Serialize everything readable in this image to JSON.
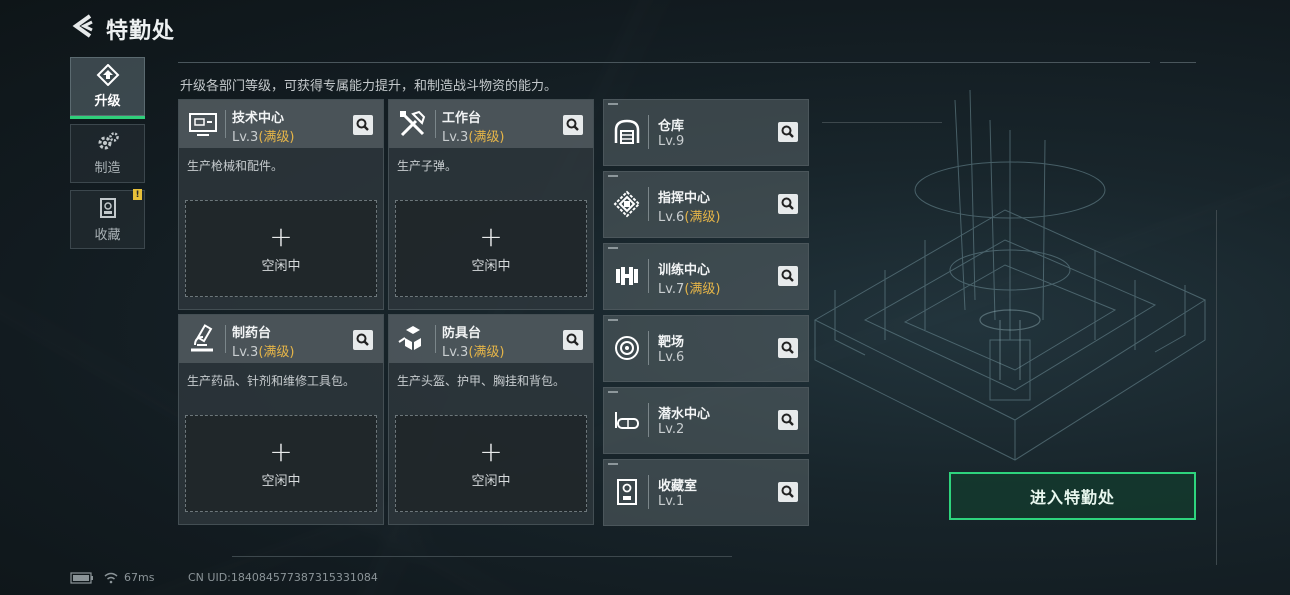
{
  "header": {
    "title": "特勤处"
  },
  "description": "升级各部门等级，可获得专属能力提升，和制造战斗物资的能力。",
  "nav": [
    {
      "label": "升级",
      "icon": "upgrade-icon",
      "active": true
    },
    {
      "label": "制造",
      "icon": "gears-icon"
    },
    {
      "label": "收藏",
      "icon": "collection-icon",
      "badge": "!"
    }
  ],
  "cards": [
    {
      "name": "技术中心",
      "level": "Lv.3",
      "max": "(满级)",
      "desc": "生产枪械和配件。",
      "icon": "computer-icon"
    },
    {
      "name": "工作台",
      "level": "Lv.3",
      "max": "(满级)",
      "desc": "生产子弹。",
      "icon": "tools-icon"
    },
    {
      "name": "制药台",
      "level": "Lv.3",
      "max": "(满级)",
      "desc": "生产药品、针剂和维修工具包。",
      "icon": "microscope-icon"
    },
    {
      "name": "防具台",
      "level": "Lv.3",
      "max": "(满级)",
      "desc": "生产头盔、护甲、胸挂和背包。",
      "icon": "cubes-icon"
    }
  ],
  "slot": {
    "plus": "+",
    "idle": "空闲中"
  },
  "facilities": [
    {
      "name": "仓库",
      "level": "Lv.9",
      "max": "",
      "icon": "warehouse-icon"
    },
    {
      "name": "指挥中心",
      "level": "Lv.6",
      "max": "(满级)",
      "icon": "command-icon"
    },
    {
      "name": "训练中心",
      "level": "Lv.7",
      "max": "(满级)",
      "icon": "dumbbell-icon"
    },
    {
      "name": "靶场",
      "level": "Lv.6",
      "max": "",
      "icon": "target-icon"
    },
    {
      "name": "潜水中心",
      "level": "Lv.2",
      "max": "",
      "icon": "goggles-icon"
    },
    {
      "name": "收藏室",
      "level": "Lv.1",
      "max": "",
      "icon": "showcase-icon"
    }
  ],
  "enter_button": "进入特勤处",
  "footer": {
    "ping": "67ms",
    "uid": "CN UID:18408457738731533108​4"
  },
  "colors": {
    "accent": "#2fcf7a",
    "max_level": "#e6b548"
  }
}
